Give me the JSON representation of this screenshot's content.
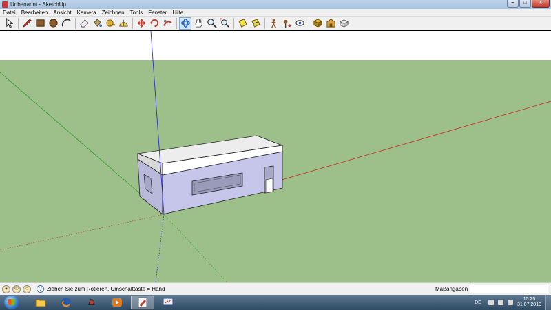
{
  "window": {
    "title": "Unbenannt - SketchUp"
  },
  "menu": [
    "Datei",
    "Bearbeiten",
    "Ansicht",
    "Kamera",
    "Zeichnen",
    "Tools",
    "Fenster",
    "Hilfe"
  ],
  "toolbar": {
    "active_tool": "orbit",
    "tools": [
      "select",
      "line",
      "rectangle",
      "circle",
      "arc",
      "eraser",
      "paint-bucket",
      "tape-measure",
      "protractor",
      "move",
      "rotate",
      "follow-me",
      "orbit",
      "pan",
      "zoom",
      "zoom-extents",
      "section-plane",
      "walk",
      "position-camera",
      "look-around",
      "components",
      "warehouse",
      "materials"
    ]
  },
  "viewport": {
    "sky_color": "#ffffff",
    "ground_color": "#9dc08b",
    "axis_colors": {
      "red": "#c0392b",
      "green": "#2e9b2e",
      "blue": "#2b2bd6"
    }
  },
  "statusbar": {
    "hint": "Ziehen Sie zum Rotieren.  Umschalttaste = Hand",
    "measurements_label": "Maßangaben",
    "measurements_value": ""
  },
  "taskbar": {
    "apps": [
      "explorer",
      "firefox",
      "game",
      "media-player",
      "sketchup",
      "presentation"
    ],
    "language": "DE",
    "time": "15:25",
    "date": "31.07.2013"
  }
}
